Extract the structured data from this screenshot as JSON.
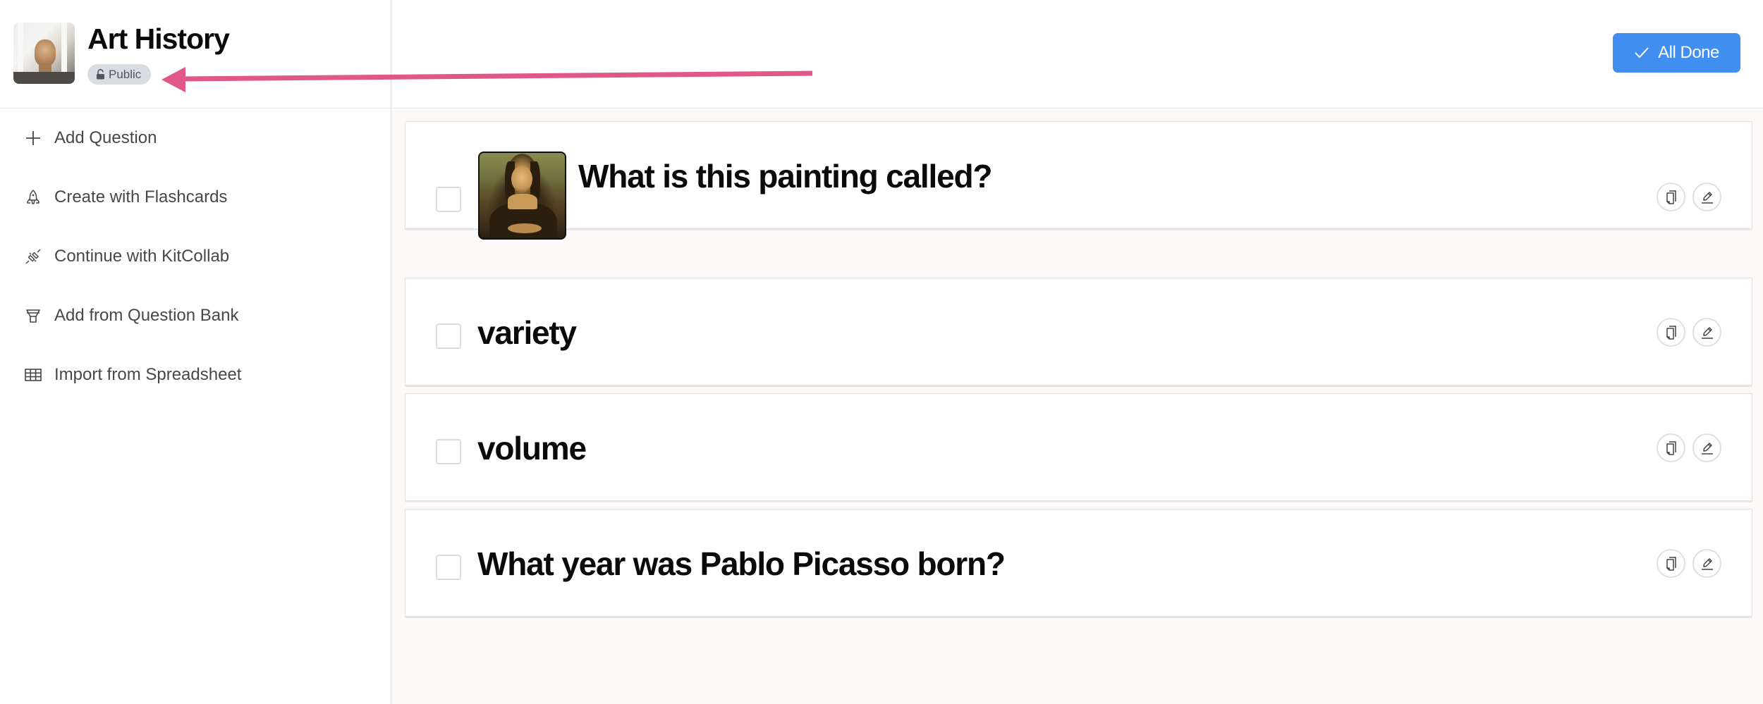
{
  "deck": {
    "title": "Art History",
    "visibility": "Public",
    "visibility_icon": "unlocked-lock-icon",
    "thumbnail": "classical-statue-bust-photo"
  },
  "sidebar": {
    "items": [
      {
        "label": "Add Question",
        "icon": "plus-icon"
      },
      {
        "label": "Create with Flashcards",
        "icon": "rocket-icon"
      },
      {
        "label": "Continue with KitCollab",
        "icon": "plug-icon"
      },
      {
        "label": "Add from Question Bank",
        "icon": "funnel-icon"
      },
      {
        "label": "Import from Spreadsheet",
        "icon": "table-icon"
      }
    ]
  },
  "toolbar": {
    "all_done_label": "All Done",
    "all_done_icon": "checkmark-icon",
    "accent_color": "#3f8ef0"
  },
  "questions": [
    {
      "text": "What is this painting called?",
      "checked": false,
      "image": "mona-lisa-painting"
    },
    {
      "text": "variety",
      "checked": false
    },
    {
      "text": "volume",
      "checked": false
    },
    {
      "text": "What year was Pablo Picasso born?",
      "checked": false
    }
  ],
  "question_actions": {
    "duplicate_icon": "duplicate-icon",
    "edit_icon": "pencil-icon"
  },
  "annotation": {
    "type": "arrow",
    "color": "#e0578a",
    "points_to": "visibility-badge"
  }
}
